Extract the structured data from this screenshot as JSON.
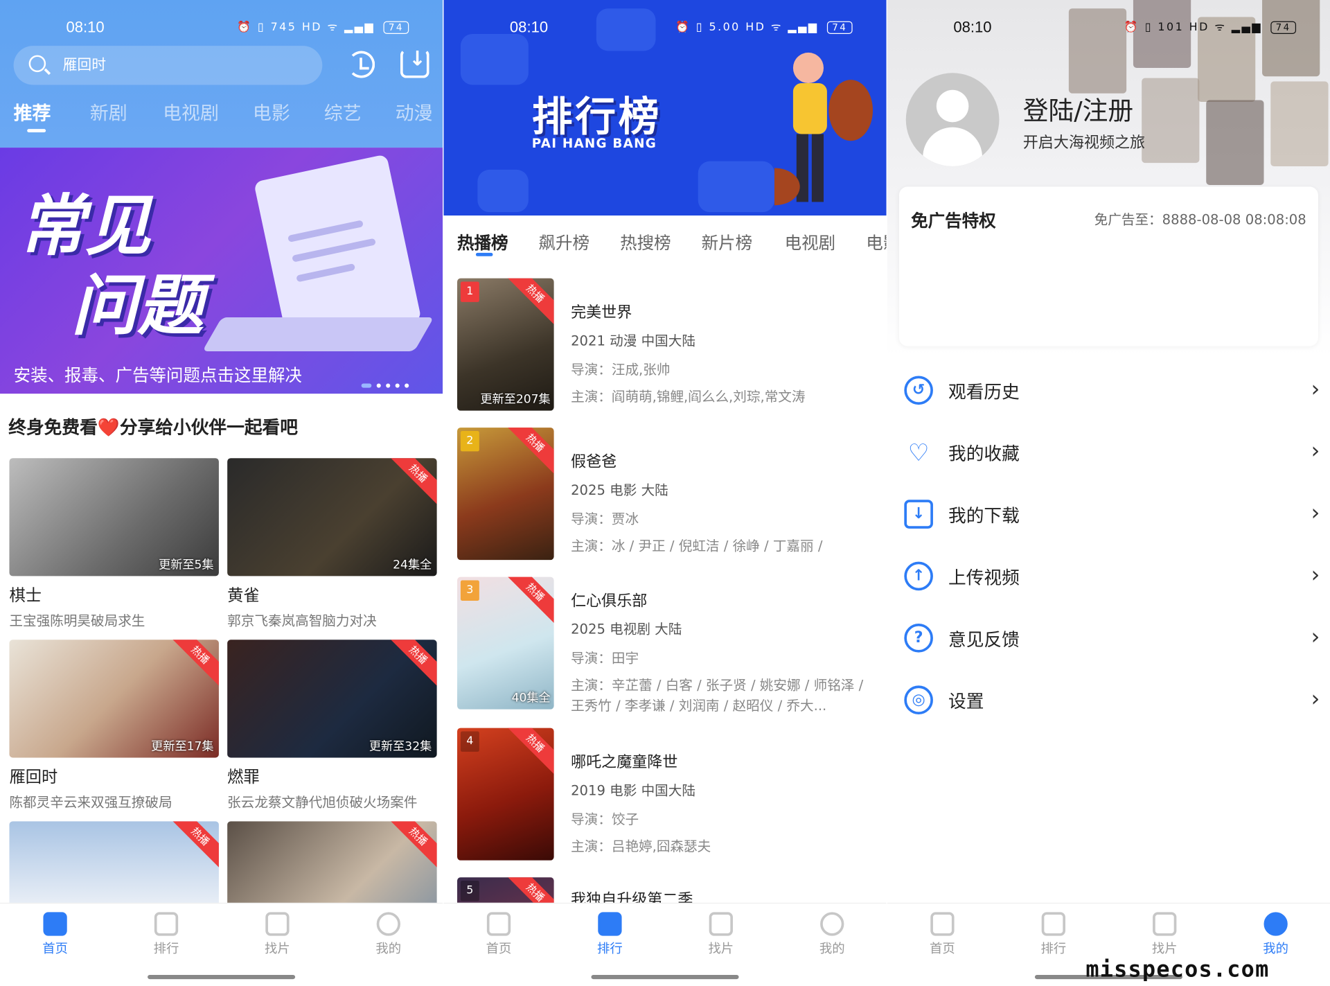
{
  "status": {
    "time": "08:10",
    "battery": "74",
    "net_s1": "745",
    "net_s2": "5.00",
    "net_s3": "101"
  },
  "home": {
    "search_text": "雁回时",
    "categories": [
      "推荐",
      "新剧",
      "电视剧",
      "电影",
      "综艺",
      "动漫"
    ],
    "banner_line1": "常见",
    "banner_line2": "问题",
    "banner_caption": "安装、报毒、广告等问题点击这里解决",
    "promo": "终身免费看❤️分享给小伙伴一起看吧",
    "hot_tag": "热播",
    "cards": [
      {
        "title": "棋士",
        "sub": "王宝强陈明昊破局求生",
        "eps": "更新至5集"
      },
      {
        "title": "黄雀",
        "sub": "郭京飞秦岚高智脑力对决",
        "eps": "24集全"
      },
      {
        "title": "雁回时",
        "sub": "陈都灵辛云来双强互撩破局",
        "eps": "更新至17集"
      },
      {
        "title": "燃罪",
        "sub": "张云龙蔡文静代旭侦破火场案件",
        "eps": "更新至32集"
      }
    ]
  },
  "nav": {
    "home": "首页",
    "rank": "排行",
    "find": "找片",
    "mine": "我的"
  },
  "rank": {
    "title": "排行榜",
    "subtitle": "PAI HANG BANG",
    "tabs": [
      "热播榜",
      "飙升榜",
      "热搜榜",
      "新片榜",
      "电视剧",
      "电影"
    ],
    "hot_tag": "热播",
    "items": [
      {
        "rank": "1",
        "title": "完美世界",
        "meta": "2021  动漫  中国大陆",
        "director": "导演：汪成,张帅",
        "actors": "主演：阎萌萌,锦鲤,阎么么,刘琮,常文涛",
        "eps": "更新至207集"
      },
      {
        "rank": "2",
        "title": "假爸爸",
        "meta": "2025  电影  大陆",
        "director": "导演：贾冰",
        "actors": "主演：冰 / 尹正 / 倪虹洁 / 徐峥 / 丁嘉丽 /",
        "eps": ""
      },
      {
        "rank": "3",
        "title": "仁心俱乐部",
        "meta": "2025  电视剧  大陆",
        "director": "导演：田宇",
        "actors": "主演：辛芷蕾 / 白客 / 张子贤 / 姚安娜 / 师铭泽 / 王秀竹 / 李孝谦 / 刘润南 / 赵昭仪 / 乔大...",
        "eps": "40集全"
      },
      {
        "rank": "4",
        "title": "哪吒之魔童降世",
        "meta": "2019  电影  中国大陆",
        "director": "导演：饺子",
        "actors": "主演：吕艳婷,囧森瑟夫",
        "eps": ""
      },
      {
        "rank": "5",
        "title": "我独自升级第二季",
        "meta": "",
        "director": "",
        "actors": "",
        "eps": ""
      }
    ]
  },
  "mine": {
    "login": "登陆/注册",
    "login_sub": "开启大海视频之旅",
    "ad_title": "免广告特权",
    "ad_expire": "免广告至：8888-08-08 08:08:08",
    "menu": [
      "观看历史",
      "我的收藏",
      "我的下载",
      "上传视频",
      "意见反馈",
      "设置"
    ],
    "menu_icons": [
      "history-icon",
      "heart-plus-icon",
      "download-icon",
      "upload-icon",
      "question-icon",
      "settings-icon"
    ]
  },
  "watermark": "misspecos.com",
  "colors": {
    "accent": "#2d7cf6",
    "hot": "#ee3b3b",
    "home_header": "#5fa3f2",
    "rank_header": "#1e47e0"
  }
}
